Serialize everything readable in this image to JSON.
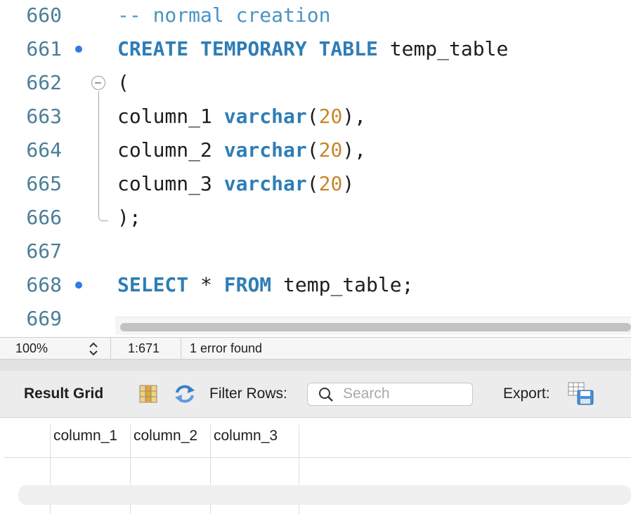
{
  "editor": {
    "lines": [
      {
        "num": "660",
        "breakpoint": false,
        "tokens": [
          {
            "t": "-- normal creation",
            "c": "cm"
          }
        ]
      },
      {
        "num": "661",
        "breakpoint": true,
        "tokens": [
          {
            "t": "CREATE TEMPORARY TABLE",
            "c": "kw"
          },
          {
            "t": " temp_table",
            "c": ""
          }
        ]
      },
      {
        "num": "662",
        "breakpoint": false,
        "tokens": [
          {
            "t": "(",
            "c": ""
          }
        ]
      },
      {
        "num": "663",
        "breakpoint": false,
        "tokens": [
          {
            "t": "column_1 ",
            "c": ""
          },
          {
            "t": "varchar",
            "c": "fn"
          },
          {
            "t": "(",
            "c": ""
          },
          {
            "t": "20",
            "c": "num"
          },
          {
            "t": "),",
            "c": ""
          }
        ]
      },
      {
        "num": "664",
        "breakpoint": false,
        "tokens": [
          {
            "t": "column_2 ",
            "c": ""
          },
          {
            "t": "varchar",
            "c": "fn"
          },
          {
            "t": "(",
            "c": ""
          },
          {
            "t": "20",
            "c": "num"
          },
          {
            "t": "),",
            "c": ""
          }
        ]
      },
      {
        "num": "665",
        "breakpoint": false,
        "tokens": [
          {
            "t": "column_3 ",
            "c": ""
          },
          {
            "t": "varchar",
            "c": "fn"
          },
          {
            "t": "(",
            "c": ""
          },
          {
            "t": "20",
            "c": "num"
          },
          {
            "t": ")",
            "c": ""
          }
        ]
      },
      {
        "num": "666",
        "breakpoint": false,
        "tokens": [
          {
            "t": ");",
            "c": ""
          }
        ]
      },
      {
        "num": "667",
        "breakpoint": false,
        "tokens": []
      },
      {
        "num": "668",
        "breakpoint": true,
        "tokens": [
          {
            "t": "SELECT",
            "c": "kw"
          },
          {
            "t": " * ",
            "c": ""
          },
          {
            "t": "FROM",
            "c": "kw"
          },
          {
            "t": " temp_table;",
            "c": ""
          }
        ]
      },
      {
        "num": "669",
        "breakpoint": false,
        "tokens": []
      }
    ]
  },
  "status": {
    "zoom": "100%",
    "cursor": "1:671",
    "message": "1 error found"
  },
  "toolbar": {
    "result_grid_label": "Result Grid",
    "filter_label": "Filter Rows:",
    "search_placeholder": "Search",
    "search_value": "",
    "export_label": "Export:"
  },
  "grid": {
    "columns": [
      "column_1",
      "column_2",
      "column_3"
    ]
  },
  "colors": {
    "keyword": "#2f7db6",
    "number": "#c8852a",
    "comment": "#4a94c2",
    "line_number": "#4a7e98",
    "breakpoint": "#2f7ae5"
  },
  "icons": {
    "zoom_stepper": "chevron-up-down-icon",
    "result_grid_toggle": "grid-columns-icon",
    "refresh": "refresh-arrows-icon",
    "search": "magnifier-icon",
    "export": "export-save-icon"
  }
}
